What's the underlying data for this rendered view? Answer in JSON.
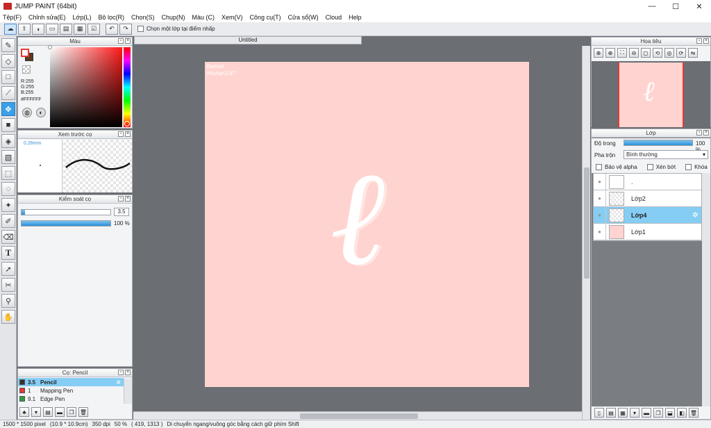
{
  "window": {
    "title": "JUMP PAINT (64bit)",
    "minimize": "—",
    "maximize": "☐",
    "close": "✕"
  },
  "menu": [
    "Tệp(F)",
    "Chỉnh sửa(E)",
    "Lớp(L)",
    "Bộ lọc(R)",
    "Chọn(S)",
    "Chụp(N)",
    "Màu (C)",
    "Xem(V)",
    "Công cụ(T)",
    "Cửa sổ(W)",
    "Cloud",
    "Help"
  ],
  "toolbar": {
    "snap_label": "Chọn một lớp tại điểm nhấp"
  },
  "color_panel": {
    "title": "Màu",
    "r": "R:255",
    "g": "G:255",
    "b": "B:255",
    "hex": "#FFFFFF",
    "colors": {
      "fg": "#ffffff",
      "bg": "#5a3a1e"
    }
  },
  "brush_preview": {
    "title": "Xem trước cọ",
    "size": "0.26mm"
  },
  "brush_control": {
    "title": "Kiểm soát cọ",
    "size_value": "3.5",
    "opacity_value": "100 %",
    "size_fraction": 0.04,
    "opacity_fraction": 1.0
  },
  "brush_list": {
    "title": "Cọ: Pencil",
    "items": [
      {
        "size": "3.5",
        "name": "Pencil",
        "color": "#333333",
        "selected": true
      },
      {
        "size": "1",
        "name": "Mapping Pen",
        "color": "#e53935",
        "selected": false
      },
      {
        "size": "9.1",
        "name": "Edge Pen",
        "color": "#2e9e3a",
        "selected": false
      }
    ]
  },
  "document": {
    "tab_title": "Untitled",
    "canvas_color": "#ffd3cf",
    "watermark_line1": "Bamon",
    "watermark_line2": "#kiulap1147",
    "glyph": "ℓ"
  },
  "navigator": {
    "title": "Hoa tiêu"
  },
  "layers": {
    "title": "Lớp",
    "opacity_label": "Độ trong",
    "opacity_value": "100 %",
    "opacity_fraction": 1.0,
    "blend_label": "Pha trộn",
    "blend_value": "Bình thường",
    "protect_alpha": "Bảo vệ alpha",
    "clipping": "Xén bớt",
    "lock": "Khóa",
    "items": [
      {
        "name": ".",
        "selected": false,
        "thumb": "#ffffff"
      },
      {
        "name": "Lớp2",
        "selected": false,
        "thumb": "checker"
      },
      {
        "name": "Lớp4",
        "selected": true,
        "thumb": "checker"
      },
      {
        "name": "Lớp1",
        "selected": false,
        "thumb": "#ffd3cf"
      }
    ]
  },
  "status": {
    "size": "1500 * 1500 pixel",
    "physical": "(10.9 * 10.9cm)",
    "dpi": "350 dpi",
    "zoom": "50 %",
    "coords": "( 419, 1313 )",
    "hint": "Di chuyển ngang/vuông góc bằng cách giữ phím Shift"
  }
}
